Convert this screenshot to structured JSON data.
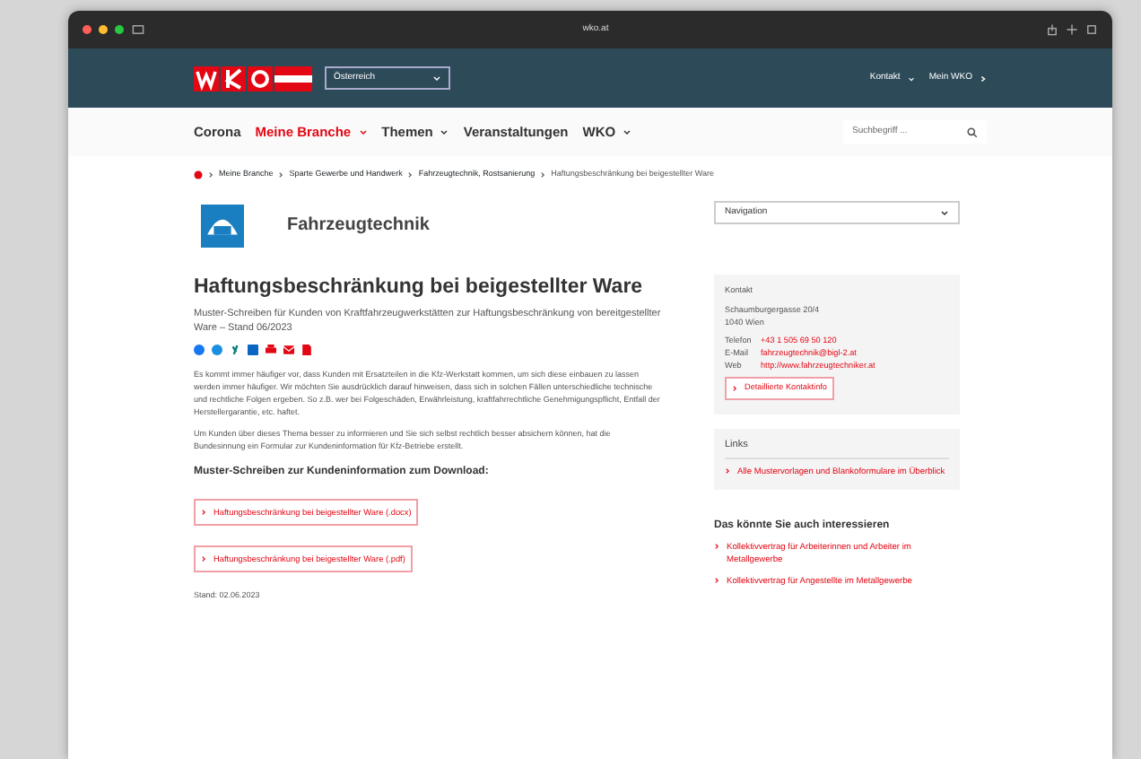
{
  "browser": {
    "address": "wko.at"
  },
  "header": {
    "region_select": "Österreich",
    "links": [
      {
        "label": "Kontakt",
        "kind": "menu"
      },
      {
        "label": "Mein WKO",
        "kind": "link"
      }
    ]
  },
  "nav": {
    "items": [
      {
        "label": "Corona",
        "selected": false,
        "has_menu": false
      },
      {
        "label": "Meine Branche",
        "selected": true,
        "has_menu": true
      },
      {
        "label": "Themen",
        "selected": false,
        "has_menu": true
      },
      {
        "label": "Veranstaltungen",
        "selected": false,
        "has_menu": false
      },
      {
        "label": "WKO",
        "selected": false,
        "has_menu": true
      }
    ],
    "search_placeholder": "Suchbegriff ..."
  },
  "breadcrumb": [
    "Meine Branche",
    "Sparte Gewerbe und Handwerk",
    "Fahrzeugtechnik, Rostsanierung",
    "Haftungsbeschränkung bei beigestellter Ware"
  ],
  "branch": {
    "name": "Fahrzeugtechnik"
  },
  "article": {
    "title": "Haftungsbeschränkung bei beigestellter Ware",
    "subtitle": "Muster-Schreiben für Kunden von Kraftfahrzeugwerkstätten zur Haftungsbeschränkung von bereitgestellter Ware – Stand 06/2023",
    "paragraphs": [
      "Es kommt immer häufiger vor, dass Kunden mit Ersatzteilen in die Kfz-Werkstatt kommen, um sich diese einbauen zu lassen werden immer häufiger. Wir möchten Sie ausdrücklich darauf hinweisen, dass sich in solchen Fällen unterschiedliche technische und rechtliche Folgen ergeben. So z.B. wer bei Folgeschäden, Erwährleistung, kraftfahrrechtliche Genehmigungspflicht, Entfall der Herstellergarantie, etc. haftet.",
      "Um Kunden über dieses Thema besser zu informieren und Sie sich selbst rechtlich besser absichern können, hat die Bundesinnung ein Formular zur Kundeninformation für Kfz-Betriebe erstellt."
    ],
    "downloads_heading": "Muster-Schreiben zur Kundeninformation zum Download:",
    "downloads": [
      "Haftungsbeschränkung bei beigestellter Ware (.docx)",
      "Haftungsbeschränkung bei beigestellter Ware (.pdf)"
    ],
    "date": "Stand: 02.06.2023"
  },
  "sidebar": {
    "navigation_select": "Navigation",
    "contact": {
      "heading": "Kontakt",
      "address": [
        "Schaumburgergasse 20/4",
        "1040 Wien"
      ],
      "rows": [
        {
          "label": "Telefon",
          "value": "+43 1 505 69 50 120"
        },
        {
          "label": "E-Mail",
          "value": "fahrzeugtechnik@bigl-2.at"
        },
        {
          "label": "Web",
          "value": "http://www.fahrzeugtechniker.at"
        }
      ],
      "button": "Detaillierte Kontaktinfo"
    },
    "links": {
      "heading": "Links",
      "items": [
        "Alle Mustervorlagen und Blankoformulare im Überblick"
      ]
    },
    "related": {
      "heading": "Das könnte Sie auch interessieren",
      "items": [
        "Kollektivvertrag für Arbeiterinnen und Arbeiter im Metallgewerbe",
        "Kollektivvertrag für Angestellte im Metallgewerbe"
      ]
    }
  }
}
